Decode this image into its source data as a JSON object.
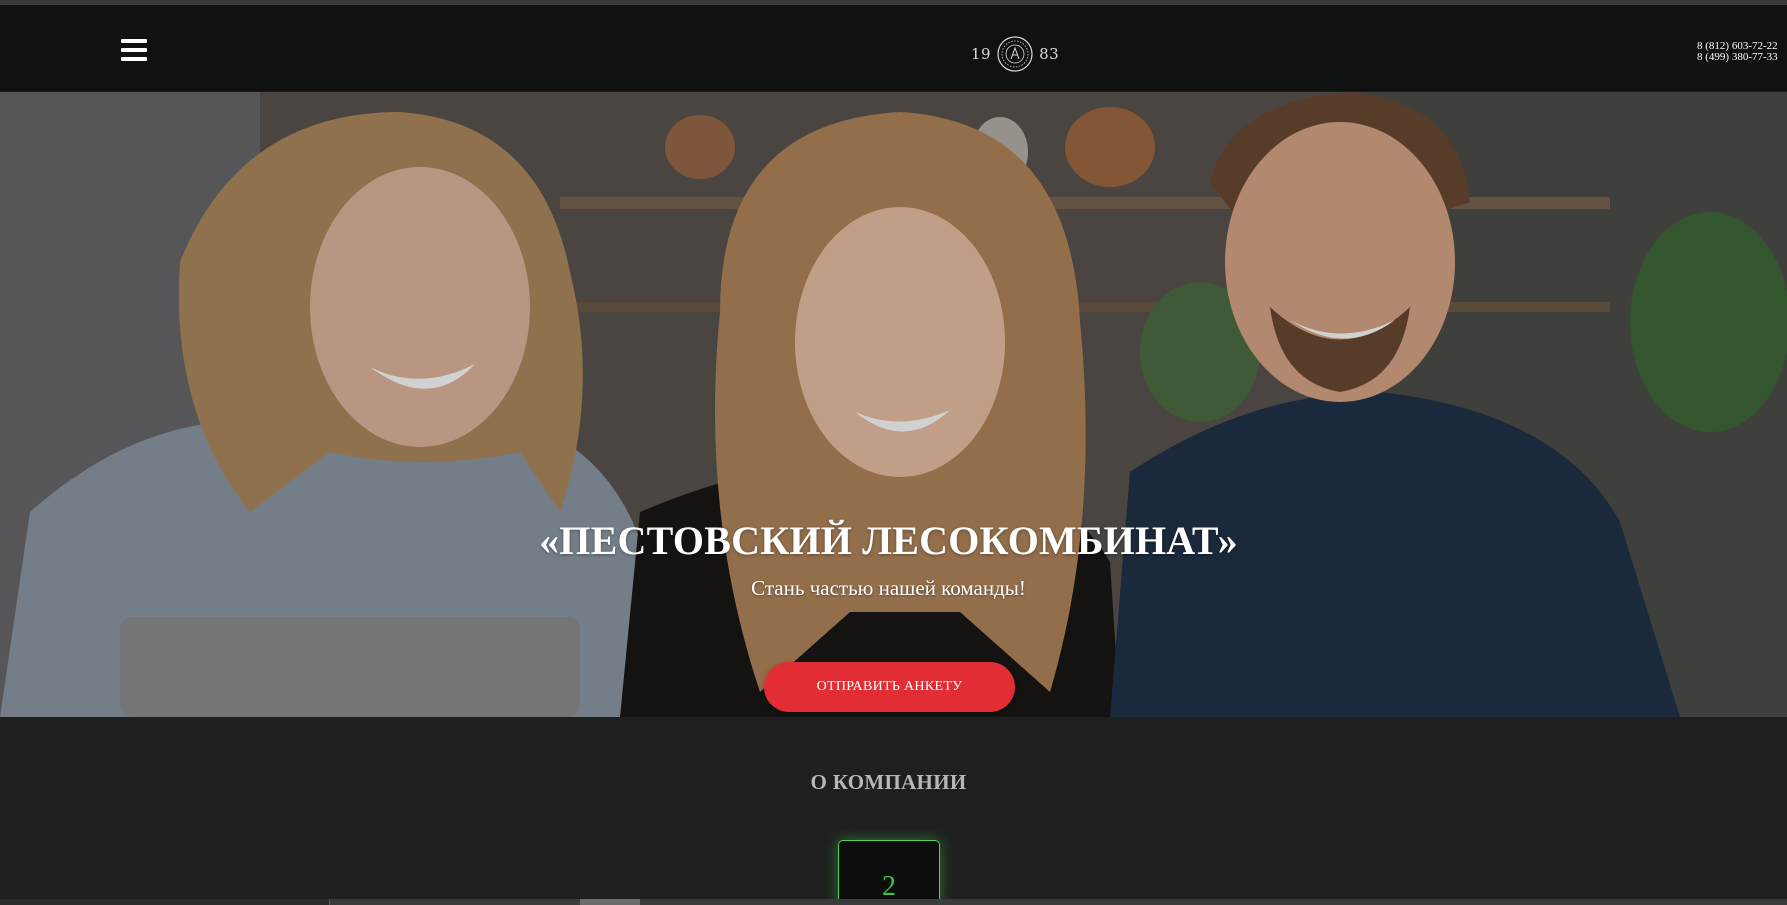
{
  "header": {
    "menu_icon": "hamburger-menu-icon",
    "logo": {
      "year_left": "19",
      "year_right": "83",
      "emblem_icon": "company-seal-icon"
    },
    "phones": [
      "8 (812) 603-72-22",
      "8 (499) 380-77-33"
    ]
  },
  "hero": {
    "title": "«ПЕСТОВСКИЙ ЛЕСОКОМБИНАТ»",
    "subtitle": "Стань частью нашей команды!",
    "cta_label": "ОТПРАВИТЬ АНКЕТУ",
    "cta_color": "#e22d35"
  },
  "about": {
    "title": "О КОМПАНИИ",
    "stat_value": "2",
    "accent_color": "#38c24a"
  }
}
